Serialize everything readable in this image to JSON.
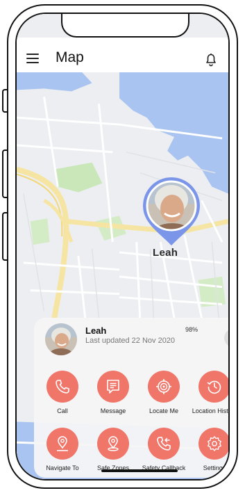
{
  "header": {
    "title": "Map"
  },
  "map_pin": {
    "name": "Leah"
  },
  "card": {
    "name": "Leah",
    "last_updated": "Last updated 22 Nov 2020",
    "battery": "98%"
  },
  "actions": [
    {
      "label": "Call",
      "icon": "phone-icon"
    },
    {
      "label": "Message",
      "icon": "message-icon"
    },
    {
      "label": "Locate Me",
      "icon": "target-icon"
    },
    {
      "label": "Location History",
      "icon": "history-icon"
    },
    {
      "label": "Navigate To",
      "icon": "navigate-pin-icon"
    },
    {
      "label": "Safe Zones",
      "icon": "safe-zone-pin-icon"
    },
    {
      "label": "Safety Callback",
      "icon": "callback-phone-icon"
    },
    {
      "label": "Settings",
      "icon": "gear-icon"
    }
  ],
  "colors": {
    "accent": "#f0766a",
    "pin_ring": "#7b96e8",
    "water": "#a9c4f0"
  }
}
